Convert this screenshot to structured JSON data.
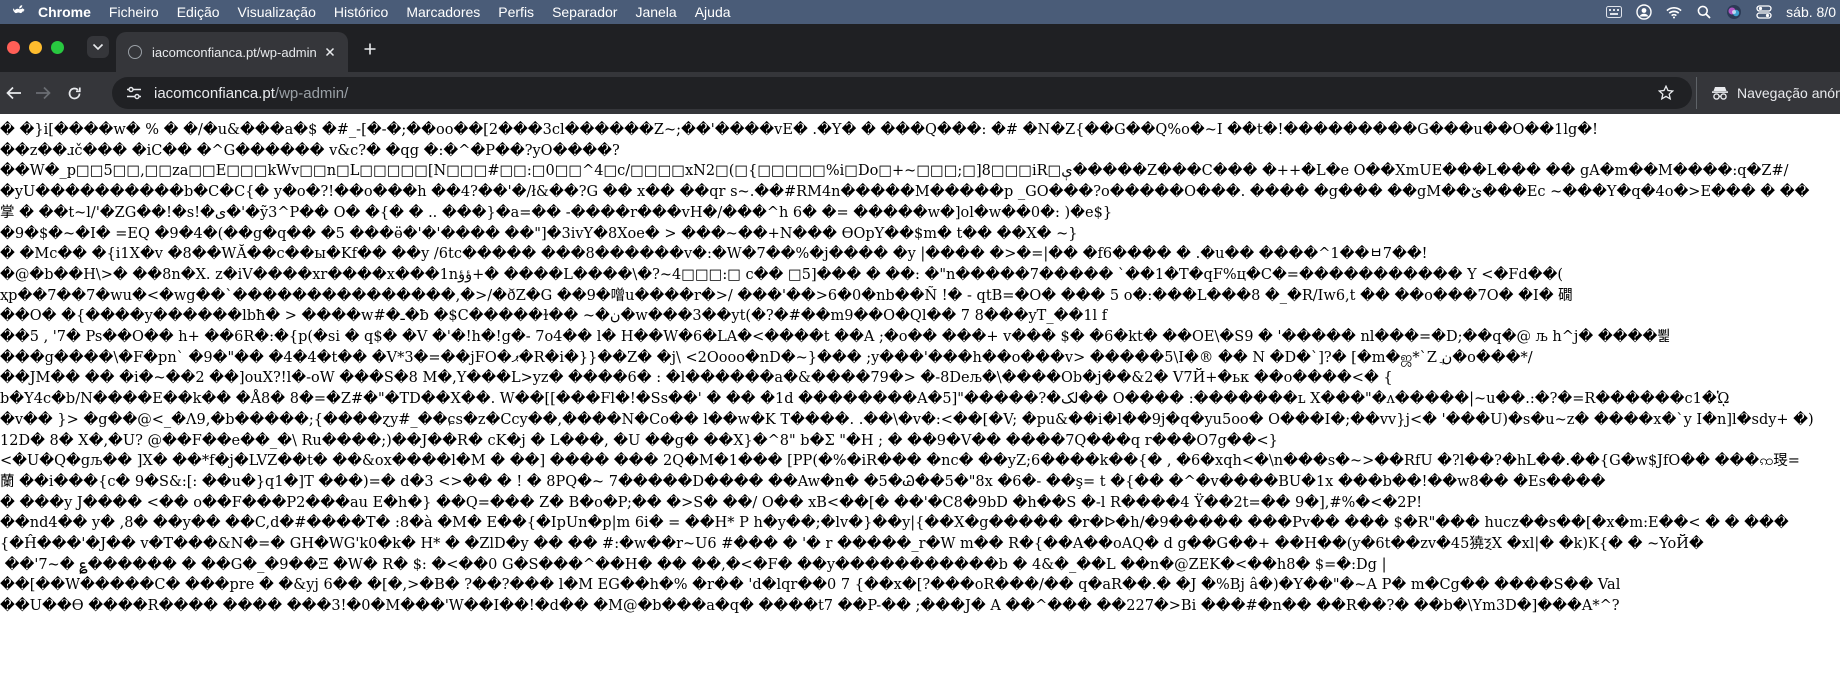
{
  "menubar": {
    "app_name": "Chrome",
    "items": [
      "Ficheiro",
      "Edição",
      "Visualização",
      "Histórico",
      "Marcadores",
      "Perfis",
      "Separador",
      "Janela",
      "Ajuda"
    ],
    "clock": "sáb. 8/0",
    "bg_color": "#4a5c78"
  },
  "tabs": [
    {
      "title": "iacomconfianca.pt/wp-admin/",
      "icon": "globe-icon",
      "active": true
    }
  ],
  "toolbar": {
    "url_host": "iacomconfianca.pt",
    "url_path": "/wp-admin/",
    "profile_label": "Navegação anónima"
  },
  "content": {
    "lines": [
      "� �}i[����w� % � �/�u&���a�$ �#_-[�-�;��oo��[2���3cl������Z~;��'����vE� .�Y� � ���Q���: �# �N�Z{��G��Q%o�~I ��t�!���������G���u��O��1lg�!",
      "��z��ɹč��� �iC�� �^G������ v&c?� �qg �:�^�P��?yO����?",
      "��W�_p□□5□□,□□za□□E□□□kWv□□n□L□□□□□[N□□□#□□:□0□□^4□c/□□□□xN2□(□{□□□□□%i□Do□+~□□□;□]8□□□iR□ې�����Z���C��� �++�L�e O��XmUE���L��� �� gA�m��M����:q�Z#/",
      "�yU����������b�C�C{� y�o�?!��o���h ��4?��'�/ł&��?G �� x�� ��qr s~.��#RM4n�����M�����p _GO���?o�����O���. ���� �g��� ��gM��ێ���Ec ~���Y�q�4o�>E��� � ��",
      "掌 � ��t~l/'�ZG��!�s!�ی�'�ỹ3^P�� O� �{� � .. ���}�a=�� -����r���vH�/���^h 6� �= �����w�]ol�w��0�: )�e$}",
      "�9�$�~�I� =EQ �9�4�(��g�q�� �5 ���ӫ�'�'���� ��\"]�3ivY�8Xoe� > ���~��+N��� ѲOpY��$m� t�� ��X� ~}",
      "� �Mc�� �{i1X�v �8��WĂ��c��ы�Kf�� ��y /6tc����� ���8������v�:�W�7��%�j���� �y |���� �>�=|�� �f6���� � .�u�� ����^1��ㅂ7��!",
      "�@�b��H\\>� ��8n�X. z�iV����xr����x���1nؤؤ+� ����L����\\�?~4□□□:□ c�� □5]��� � ��: �\"n�����7����� `��1�T�qF%ц�C�=����������� Y <�Fd��(",
      "ҳp��7��7�wu�<�wg��`���������������,�>/�ðZ�G ��9�噌u����r�>/ ���'��>6�0�nb��Ñ !� - qtB=�O� ��� 5 o�:���L���8 �_�R/Iw6,t �� ��o���7O� �I� 礀",
      "��O� �{����y������lbħ� > ����w#�ـ�ƀ �$C�����ɫ�� ~�ن�w���3��yt(�?�#��m9��O�Ql�� 7 8���yT_��1l f",
      "��5 , '7� Ps��O�� h+ ��6R�:�{p(�si � q$� �V �'�!h�!g�- 7o4�� l� H��W�6�LA�<����t ��A ;�o�� ���+ v��� $� �6�kt� ��OE\\�S9 � '����� nl���=�D;��q�@ љ h^j� ����뾡",
      "���g����\\�F�pn` �9�\"�� �4�4�t�� �V*3�=��jFO�ޕ�R�i�}}��Z� �j\\ <2Oooo�nD�~}��� ;y���'���h��o���v> �����5\\I�® �� N �D�`]?� [�m�ஜ*`Z نֲ�o���*/",
      "��JM�� �� �i�~��2 ��]ouX?!l�-oW ���S�8 M�,Y���L>yz� ����6� : �l������a�&����79�> �-8Deљ�\\����Ob�j��&2� V7Й+�ьк ��o����<� {",
      "b�Y4c�b/N����E��k�� �Å8� 8�=�Z#�\"�TD��X��. W��[[���Fl�!�Ss��' � �� �1d ��������A�5]\"�����?�لک�� O���� :�������ʟ X���\"�ʌ�����|~u��.:�?�=R������c1�ᾩ",
      "�v�� }> �g��@<_�Λ9,�b�����;{����ɀy#_��ɕs�z�Ccy��,����N�Co�� l��w�K T����. .��\\�v�:<��[�V; �pu&��i�l��9j�q�yu5oo� O���I�;��vv}j<� '���U)�s�u~z� ����x�`y I�n]l�sdy+ �)",
      "12D� 8� X�,�U? @��F��e��_�\\ Ru����;)��J��R� cK�j � L���, �U ��g� ��X}�^8\" b�Σ \"�H ; � ��9�V�� ����7Q���q r���O7g��<}",
      "<�U�Q�gљ�� ]X� ��*f�j�LVZ��t� ��&ox����l�M � ��] ���� ��� 2Q�M�1��� [PP(�%�iR��� �nc� ��yZ;6����k��{� , �6�xqh<�\\n���s�~>��RfU �?l��?�hL��.��{G�w$JfO�� ���ꩡ琝=",
      "蘭 ��i���{c� 9�S&:[: ��u�}q1�]T ���)=� d�3 <>�� � ! � 8PQ�~ 7�����D���� ��Aw�n� �5�Ꮚ��5�\"8x �6�- ��ş= t �{�� �^�v����BU�1x ���b��!��w8�� �Es����",
      "� ���y J���� <�� o��F���P2���au E�h�} ��Q=��� Z� B�o�P;�� �>S� ��/ O�� xB<��[� ��'�C8�9bD �h��S �-l R����4 Ÿ��2t=�� 9�],#%�<�2P!",
      "��nd4�� y� ,8� ��y�� ��C,d�#����T� :8�à �M� E��{�IpUn�p|m 6i� = ��H* P h�y��;�lv�}��y|{��X�g����� �r�ᐅ�h/�9����� ���Pv�� ��� $�R\"��� hucz��s��[�x�m:E��< � � ���",
      "{�Ĥ���'�J�� v�T���&N�=� GH�WG'k0�k� H* � �ZlD�y �� �� #:�w��r~U6 #��� � '� r �����_r�W m�� R�{��A��oAQ� d g��G��+ ��H��(y�6t��zv�45獟ⲜX �xl|� �k)K{� � ~YoЙ�",
      " ��'7~� ؏������ � ��G�_�9��Ξ �W� R� $: �<��0 G�S���^��H� �� ��,�<�F� ��y�����������b � 4&�_��L ��n�@ZEK�<��h8� $=�:Dg |",
      "��[��W�����C� ���pre � �&yj 6�� �[�,>�B� ?��?��� l�M EG��h�% �r�� 'd�lqr��0 7 {��x�[?���oR���/�� q�aR��.� �J �%Bj â�)�Y��\"�~A P� m�Cg�� ����S�� Val",
      "��U��Ѳ ����R���� ���� ���3!�0�M���'W��I��!�d�� �M@�b���a�q� ����t7 ��P-�� ;���J� A ��^��� ��227�>Bi ���#�n�� ��R��?� ��b�\\Ym3D�]���A*^?"
    ]
  }
}
